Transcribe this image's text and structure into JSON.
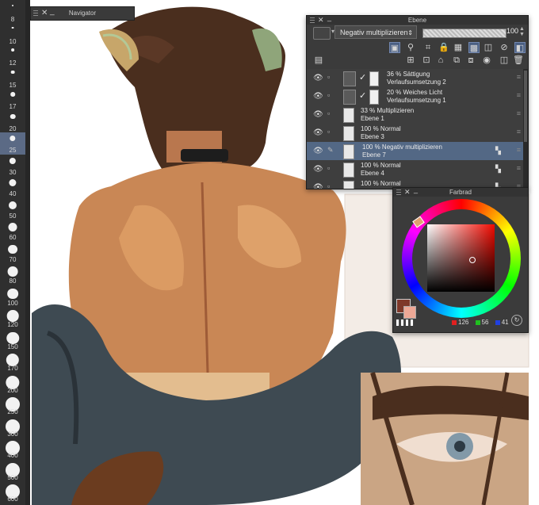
{
  "brush_sizes": [
    "8",
    "10",
    "12",
    "15",
    "17",
    "20",
    "25",
    "30",
    "40",
    "50",
    "60",
    "70",
    "80",
    "100",
    "120",
    "150",
    "170",
    "200",
    "250",
    "300",
    "400",
    "500",
    "600"
  ],
  "brush_active_index": 6,
  "navigator": {
    "title": "Navigator",
    "close": "✕",
    "minimize": "_"
  },
  "layer_panel": {
    "title": "Ebene",
    "close": "✕",
    "minimize": "_",
    "blend_mode": "Negativ multiplizieren",
    "opacity_value": "100",
    "layers": [
      {
        "percent": "36 %",
        "mode": "Sättigung",
        "name": "Verlaufsumsetzung 2",
        "visible": true,
        "selected": false,
        "type": "correction"
      },
      {
        "percent": "20 %",
        "mode": "Weiches Licht",
        "name": "Verlaufsumsetzung 1",
        "visible": true,
        "selected": false,
        "type": "correction"
      },
      {
        "percent": "33 %",
        "mode": "Multiplizieren",
        "name": "Ebene 1",
        "visible": true,
        "selected": false,
        "type": "raster"
      },
      {
        "percent": "100 %",
        "mode": "Normal",
        "name": "Ebene 3",
        "visible": true,
        "selected": false,
        "type": "raster"
      },
      {
        "percent": "100 %",
        "mode": "Negativ multiplizieren",
        "name": "Ebene 7",
        "visible": true,
        "selected": true,
        "type": "raster"
      },
      {
        "percent": "100 %",
        "mode": "Normal",
        "name": "Ebene 4",
        "visible": true,
        "selected": false,
        "type": "raster"
      },
      {
        "percent": "100 %",
        "mode": "Normal",
        "name": "",
        "visible": true,
        "selected": false,
        "type": "raster"
      }
    ]
  },
  "color_panel": {
    "title": "Farbrad",
    "close": "✕",
    "minimize": "_",
    "main_color": "#7e3829",
    "sub_color": "#eda896",
    "rgb": {
      "r": "126",
      "g": "56",
      "b": "41"
    }
  },
  "colors": {
    "accent_selected": "#536885",
    "panel_bg": "#3b3b3b",
    "panel_head": "#333333"
  }
}
